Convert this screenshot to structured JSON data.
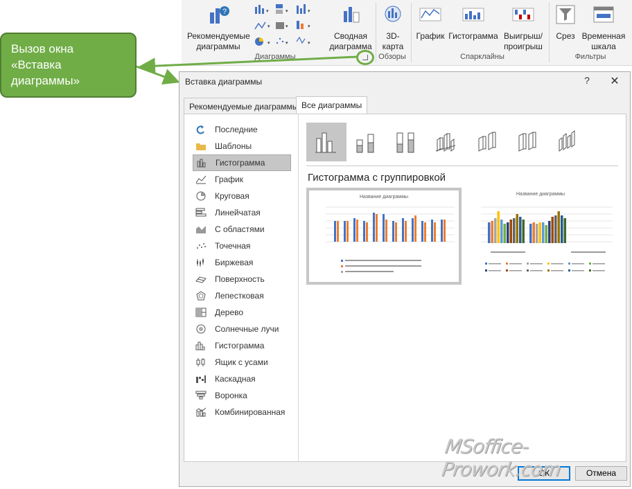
{
  "ribbon": {
    "recommended_charts": "Рекомендуемые диаграммы",
    "pivot_chart": "Сводная диаграмма",
    "map_3d": "3D-карта",
    "sparkline_line": "График",
    "sparkline_column": "Гистограмма",
    "sparkline_winloss": "Выигрыш/ проигрыш",
    "slicer": "Срез",
    "timeline": "Временная шкала",
    "group_charts": "Диаграммы",
    "group_tours": "Обзоры",
    "group_sparklines": "Спарклайны",
    "group_filters": "Фильтры"
  },
  "callout": {
    "text": "Вызов окна «Вставка диаграммы»"
  },
  "dialog": {
    "title": "Вставка диаграммы",
    "help": "?",
    "close": "✕",
    "tabs": [
      {
        "label": "Рекомендуемые диаграммы",
        "active": false
      },
      {
        "label": "Все диаграммы",
        "active": true
      }
    ],
    "chart_types": [
      {
        "label": "Последние",
        "icon": "recent-icon"
      },
      {
        "label": "Шаблоны",
        "icon": "folder-icon"
      },
      {
        "label": "Гистограмма",
        "icon": "column-chart-icon",
        "selected": true
      },
      {
        "label": "График",
        "icon": "line-chart-icon"
      },
      {
        "label": "Круговая",
        "icon": "pie-chart-icon"
      },
      {
        "label": "Линейчатая",
        "icon": "bar-chart-icon"
      },
      {
        "label": "С областями",
        "icon": "area-chart-icon"
      },
      {
        "label": "Точечная",
        "icon": "scatter-chart-icon"
      },
      {
        "label": "Биржевая",
        "icon": "stock-chart-icon"
      },
      {
        "label": "Поверхность",
        "icon": "surface-chart-icon"
      },
      {
        "label": "Лепестковая",
        "icon": "radar-chart-icon"
      },
      {
        "label": "Дерево",
        "icon": "treemap-chart-icon"
      },
      {
        "label": "Солнечные лучи",
        "icon": "sunburst-chart-icon"
      },
      {
        "label": "Гистограмма",
        "icon": "histogram-chart-icon"
      },
      {
        "label": "Ящик с усами",
        "icon": "box-whisker-chart-icon"
      },
      {
        "label": "Каскадная",
        "icon": "waterfall-chart-icon"
      },
      {
        "label": "Воронка",
        "icon": "funnel-chart-icon"
      },
      {
        "label": "Комбинированная",
        "icon": "combo-chart-icon"
      }
    ],
    "subtype_title": "Гистограмма с группировкой",
    "preview1_title": "Название диаграммы",
    "preview2_title": "Название диаграммы",
    "ok": "ОК",
    "cancel": "Отмена"
  },
  "watermark": "MSoffice-Prowork.com"
}
